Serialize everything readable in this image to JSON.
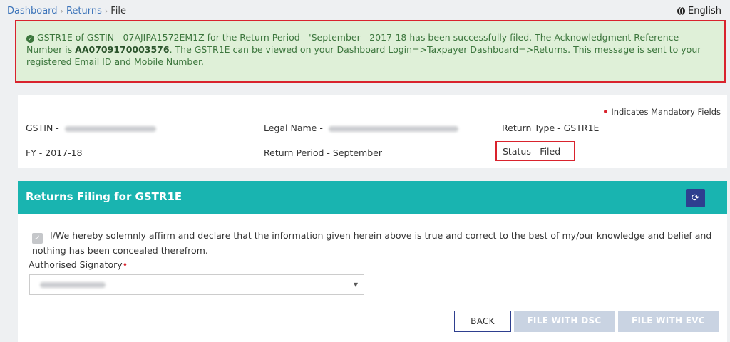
{
  "breadcrumb": {
    "items": [
      "Dashboard",
      "Returns",
      "File"
    ]
  },
  "language": "English",
  "alert": {
    "text_part1": "GSTR1E of GSTIN - 07AJIPA1572EM1Z for the Return Period - 'September - 2017-18 has been successfully filed. The Acknowledgment Reference Number is ",
    "ack_number": "AA0709170003576",
    "text_part2": ". The GSTR1E can be viewed on your Dashboard Login=>Taxpayer Dashboard=>Returns. This message is sent to your registered Email ID and Mobile Number."
  },
  "info": {
    "mandatory_note": "Indicates Mandatory Fields",
    "gstin_label": "GSTIN -",
    "legal_name_label": "Legal Name -",
    "return_type": "Return Type - GSTR1E",
    "fy": "FY - 2017-18",
    "return_period": "Return Period - September",
    "status": "Status - Filed"
  },
  "filing": {
    "title": "Returns Filing for GSTR1E",
    "declaration": "I/We hereby solemnly affirm and declare that the information given herein above is true and correct to the best of my/our knowledge and belief and nothing has been concealed therefrom.",
    "signatory_label": "Authorised Signatory",
    "required_mark": "•",
    "buttons": {
      "back": "BACK",
      "dsc": "FILE WITH DSC",
      "evc": "FILE WITH EVC"
    }
  },
  "colors": {
    "accent": "#19b4b0",
    "alert_bg": "#dff0d8",
    "highlight_border": "#d9232d",
    "primary_dark": "#2e3f8f"
  },
  "icons": {
    "success": "check-circle-icon",
    "language": "globe-icon",
    "refresh": "refresh-icon",
    "dropdown": "caret-down-icon"
  }
}
